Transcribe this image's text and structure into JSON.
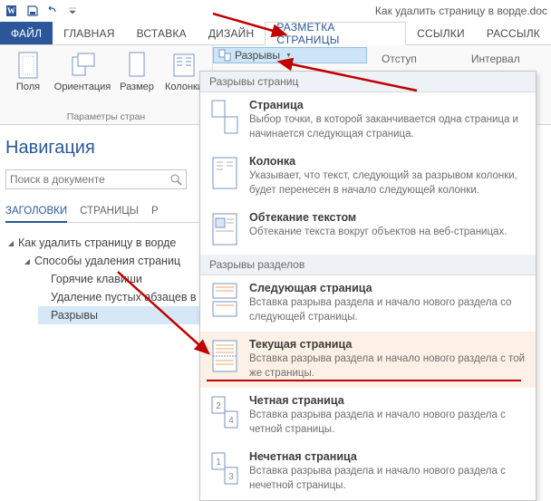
{
  "window_title": "Как удалить страницу в ворде.doc",
  "qat": {
    "word": "W",
    "save": "save-icon",
    "undo": "undo-icon",
    "customize": "customize-icon"
  },
  "tabs": {
    "file": "ФАЙЛ",
    "home": "ГЛАВНАЯ",
    "insert": "ВСТАВКА",
    "design": "ДИЗАЙН",
    "page_layout": "РАЗМЕТКА СТРАНИЦЫ",
    "references": "ССЫЛКИ",
    "mailings": "РАССЫЛК"
  },
  "ribbon": {
    "group_page_setup": "Параметры стран",
    "margins": "Поля",
    "orientation": "Ориентация",
    "size": "Размер",
    "columns": "Колонки",
    "breaks": "Разрывы",
    "indent_label": "Отступ",
    "interval_label": "Интервал"
  },
  "nav": {
    "title": "Навигация",
    "search_placeholder": "Поиск в документе",
    "tabs": {
      "headings": "ЗАГОЛОВКИ",
      "pages": "СТРАНИЦЫ",
      "results": "Р"
    },
    "tree": {
      "root": "Как удалить страницу в ворде",
      "child1": "Способы удаления страниц",
      "g1": "Горячие клавиши",
      "g2": "Удаление пустых абзацев в",
      "g3": "Разрывы"
    }
  },
  "dropdown": {
    "section_page": "Разрывы страниц",
    "section_section": "Разрывы разделов",
    "items": {
      "page": {
        "title": "Страница",
        "desc": "Выбор точки, в которой заканчивается одна страница и начинается следующая страница."
      },
      "column": {
        "title": "Колонка",
        "desc": "Указывает, что текст, следующий за разрывом колонки, будет перенесен в начало следующей колонки."
      },
      "textwrap": {
        "title": "Обтекание текстом",
        "desc": "Обтекание текста вокруг объектов на веб-страницах."
      },
      "nextpage": {
        "title": "Следующая страница",
        "desc": "Вставка разрыва раздела и начало нового раздела со следующей страницы."
      },
      "continuous": {
        "title": "Текущая страница",
        "desc": "Вставка разрыва раздела и начало нового раздела с той же страницы."
      },
      "evenpage": {
        "title": "Четная страница",
        "desc": "Вставка разрыва раздела и начало нового раздела с четной страницы."
      },
      "oddpage": {
        "title": "Нечетная страница",
        "desc": "Вставка разрыва раздела и начало нового раздела с нечетной страницы."
      }
    }
  }
}
